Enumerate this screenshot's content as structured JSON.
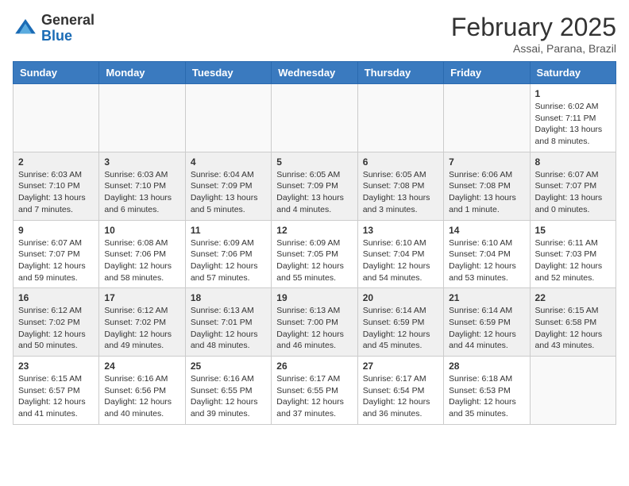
{
  "header": {
    "logo_general": "General",
    "logo_blue": "Blue",
    "month_title": "February 2025",
    "location": "Assai, Parana, Brazil"
  },
  "weekdays": [
    "Sunday",
    "Monday",
    "Tuesday",
    "Wednesday",
    "Thursday",
    "Friday",
    "Saturday"
  ],
  "weeks": [
    {
      "shaded": false,
      "days": [
        {
          "empty": true
        },
        {
          "empty": true
        },
        {
          "empty": true
        },
        {
          "empty": true
        },
        {
          "empty": true
        },
        {
          "empty": true
        },
        {
          "number": "1",
          "sunrise": "Sunrise: 6:02 AM",
          "sunset": "Sunset: 7:11 PM",
          "daylight": "Daylight: 13 hours and 8 minutes."
        }
      ]
    },
    {
      "shaded": true,
      "days": [
        {
          "number": "2",
          "sunrise": "Sunrise: 6:03 AM",
          "sunset": "Sunset: 7:10 PM",
          "daylight": "Daylight: 13 hours and 7 minutes."
        },
        {
          "number": "3",
          "sunrise": "Sunrise: 6:03 AM",
          "sunset": "Sunset: 7:10 PM",
          "daylight": "Daylight: 13 hours and 6 minutes."
        },
        {
          "number": "4",
          "sunrise": "Sunrise: 6:04 AM",
          "sunset": "Sunset: 7:09 PM",
          "daylight": "Daylight: 13 hours and 5 minutes."
        },
        {
          "number": "5",
          "sunrise": "Sunrise: 6:05 AM",
          "sunset": "Sunset: 7:09 PM",
          "daylight": "Daylight: 13 hours and 4 minutes."
        },
        {
          "number": "6",
          "sunrise": "Sunrise: 6:05 AM",
          "sunset": "Sunset: 7:08 PM",
          "daylight": "Daylight: 13 hours and 3 minutes."
        },
        {
          "number": "7",
          "sunrise": "Sunrise: 6:06 AM",
          "sunset": "Sunset: 7:08 PM",
          "daylight": "Daylight: 13 hours and 1 minute."
        },
        {
          "number": "8",
          "sunrise": "Sunrise: 6:07 AM",
          "sunset": "Sunset: 7:07 PM",
          "daylight": "Daylight: 13 hours and 0 minutes."
        }
      ]
    },
    {
      "shaded": false,
      "days": [
        {
          "number": "9",
          "sunrise": "Sunrise: 6:07 AM",
          "sunset": "Sunset: 7:07 PM",
          "daylight": "Daylight: 12 hours and 59 minutes."
        },
        {
          "number": "10",
          "sunrise": "Sunrise: 6:08 AM",
          "sunset": "Sunset: 7:06 PM",
          "daylight": "Daylight: 12 hours and 58 minutes."
        },
        {
          "number": "11",
          "sunrise": "Sunrise: 6:09 AM",
          "sunset": "Sunset: 7:06 PM",
          "daylight": "Daylight: 12 hours and 57 minutes."
        },
        {
          "number": "12",
          "sunrise": "Sunrise: 6:09 AM",
          "sunset": "Sunset: 7:05 PM",
          "daylight": "Daylight: 12 hours and 55 minutes."
        },
        {
          "number": "13",
          "sunrise": "Sunrise: 6:10 AM",
          "sunset": "Sunset: 7:04 PM",
          "daylight": "Daylight: 12 hours and 54 minutes."
        },
        {
          "number": "14",
          "sunrise": "Sunrise: 6:10 AM",
          "sunset": "Sunset: 7:04 PM",
          "daylight": "Daylight: 12 hours and 53 minutes."
        },
        {
          "number": "15",
          "sunrise": "Sunrise: 6:11 AM",
          "sunset": "Sunset: 7:03 PM",
          "daylight": "Daylight: 12 hours and 52 minutes."
        }
      ]
    },
    {
      "shaded": true,
      "days": [
        {
          "number": "16",
          "sunrise": "Sunrise: 6:12 AM",
          "sunset": "Sunset: 7:02 PM",
          "daylight": "Daylight: 12 hours and 50 minutes."
        },
        {
          "number": "17",
          "sunrise": "Sunrise: 6:12 AM",
          "sunset": "Sunset: 7:02 PM",
          "daylight": "Daylight: 12 hours and 49 minutes."
        },
        {
          "number": "18",
          "sunrise": "Sunrise: 6:13 AM",
          "sunset": "Sunset: 7:01 PM",
          "daylight": "Daylight: 12 hours and 48 minutes."
        },
        {
          "number": "19",
          "sunrise": "Sunrise: 6:13 AM",
          "sunset": "Sunset: 7:00 PM",
          "daylight": "Daylight: 12 hours and 46 minutes."
        },
        {
          "number": "20",
          "sunrise": "Sunrise: 6:14 AM",
          "sunset": "Sunset: 6:59 PM",
          "daylight": "Daylight: 12 hours and 45 minutes."
        },
        {
          "number": "21",
          "sunrise": "Sunrise: 6:14 AM",
          "sunset": "Sunset: 6:59 PM",
          "daylight": "Daylight: 12 hours and 44 minutes."
        },
        {
          "number": "22",
          "sunrise": "Sunrise: 6:15 AM",
          "sunset": "Sunset: 6:58 PM",
          "daylight": "Daylight: 12 hours and 43 minutes."
        }
      ]
    },
    {
      "shaded": false,
      "days": [
        {
          "number": "23",
          "sunrise": "Sunrise: 6:15 AM",
          "sunset": "Sunset: 6:57 PM",
          "daylight": "Daylight: 12 hours and 41 minutes."
        },
        {
          "number": "24",
          "sunrise": "Sunrise: 6:16 AM",
          "sunset": "Sunset: 6:56 PM",
          "daylight": "Daylight: 12 hours and 40 minutes."
        },
        {
          "number": "25",
          "sunrise": "Sunrise: 6:16 AM",
          "sunset": "Sunset: 6:55 PM",
          "daylight": "Daylight: 12 hours and 39 minutes."
        },
        {
          "number": "26",
          "sunrise": "Sunrise: 6:17 AM",
          "sunset": "Sunset: 6:55 PM",
          "daylight": "Daylight: 12 hours and 37 minutes."
        },
        {
          "number": "27",
          "sunrise": "Sunrise: 6:17 AM",
          "sunset": "Sunset: 6:54 PM",
          "daylight": "Daylight: 12 hours and 36 minutes."
        },
        {
          "number": "28",
          "sunrise": "Sunrise: 6:18 AM",
          "sunset": "Sunset: 6:53 PM",
          "daylight": "Daylight: 12 hours and 35 minutes."
        },
        {
          "empty": true
        }
      ]
    }
  ]
}
